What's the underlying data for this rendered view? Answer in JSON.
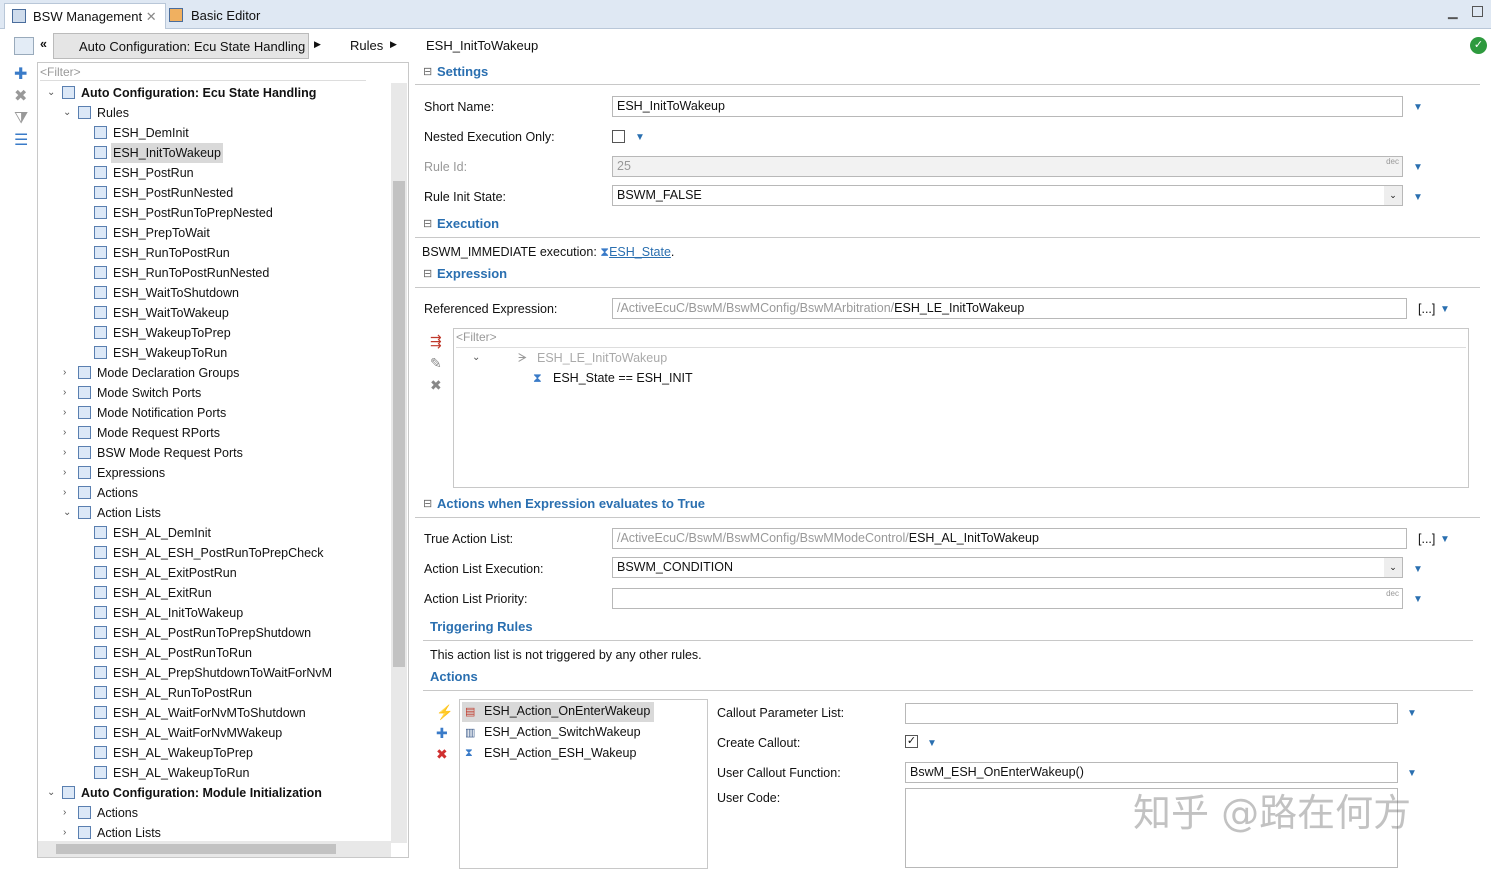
{
  "tabs": [
    {
      "label": "BSW Management",
      "active": true
    },
    {
      "label": "Basic Editor",
      "active": false
    }
  ],
  "breadcrumb": [
    "Auto Configuration: Ecu State Handling",
    "Rules",
    "ESH_InitToWakeup"
  ],
  "tree": {
    "filter_placeholder": "<Filter>",
    "items": [
      {
        "label": "Auto Configuration: Ecu State Handling",
        "level": 0,
        "bold": true,
        "expanded": true
      },
      {
        "label": "Rules",
        "level": 1,
        "expanded": true
      },
      {
        "label": "ESH_DemInit",
        "level": 2
      },
      {
        "label": "ESH_InitToWakeup",
        "level": 2,
        "selected": true
      },
      {
        "label": "ESH_PostRun",
        "level": 2
      },
      {
        "label": "ESH_PostRunNested",
        "level": 2
      },
      {
        "label": "ESH_PostRunToPrepNested",
        "level": 2
      },
      {
        "label": "ESH_PrepToWait",
        "level": 2
      },
      {
        "label": "ESH_RunToPostRun",
        "level": 2
      },
      {
        "label": "ESH_RunToPostRunNested",
        "level": 2
      },
      {
        "label": "ESH_WaitToShutdown",
        "level": 2
      },
      {
        "label": "ESH_WaitToWakeup",
        "level": 2
      },
      {
        "label": "ESH_WakeupToPrep",
        "level": 2
      },
      {
        "label": "ESH_WakeupToRun",
        "level": 2
      },
      {
        "label": "Mode Declaration Groups",
        "level": 1,
        "expanded": false
      },
      {
        "label": "Mode Switch Ports",
        "level": 1,
        "expanded": false
      },
      {
        "label": "Mode Notification Ports",
        "level": 1,
        "expanded": false
      },
      {
        "label": "Mode Request RPorts",
        "level": 1,
        "expanded": false
      },
      {
        "label": "BSW Mode Request Ports",
        "level": 1,
        "expanded": false
      },
      {
        "label": "Expressions",
        "level": 1,
        "expanded": false
      },
      {
        "label": "Actions",
        "level": 1,
        "expanded": false
      },
      {
        "label": "Action Lists",
        "level": 1,
        "expanded": true
      },
      {
        "label": "ESH_AL_DemInit",
        "level": 2
      },
      {
        "label": "ESH_AL_ESH_PostRunToPrepCheck",
        "level": 2
      },
      {
        "label": "ESH_AL_ExitPostRun",
        "level": 2
      },
      {
        "label": "ESH_AL_ExitRun",
        "level": 2
      },
      {
        "label": "ESH_AL_InitToWakeup",
        "level": 2
      },
      {
        "label": "ESH_AL_PostRunToPrepShutdown",
        "level": 2
      },
      {
        "label": "ESH_AL_PostRunToRun",
        "level": 2
      },
      {
        "label": "ESH_AL_PrepShutdownToWaitForNvM",
        "level": 2
      },
      {
        "label": "ESH_AL_RunToPostRun",
        "level": 2
      },
      {
        "label": "ESH_AL_WaitForNvMToShutdown",
        "level": 2
      },
      {
        "label": "ESH_AL_WaitForNvMWakeup",
        "level": 2
      },
      {
        "label": "ESH_AL_WakeupToPrep",
        "level": 2
      },
      {
        "label": "ESH_AL_WakeupToRun",
        "level": 2
      },
      {
        "label": "Auto Configuration: Module Initialization",
        "level": 0,
        "bold": true,
        "expanded": true
      },
      {
        "label": "Actions",
        "level": 1,
        "expanded": false
      },
      {
        "label": "Action Lists",
        "level": 1,
        "expanded": false
      }
    ]
  },
  "settings": {
    "title": "Settings",
    "short_name_label": "Short Name:",
    "short_name": "ESH_InitToWakeup",
    "nested_label": "Nested Execution Only:",
    "nested_checked": false,
    "rule_id_label": "Rule Id:",
    "rule_id": "25",
    "dec": "dec",
    "init_state_label": "Rule Init State:",
    "init_state": "BSWM_FALSE"
  },
  "execution": {
    "title": "Execution",
    "prefix": "BSWM_IMMEDIATE execution:",
    "link": "ESH_State",
    "suffix": "."
  },
  "expression": {
    "title": "Expression",
    "ref_label": "Referenced Expression:",
    "ref_path": "/ActiveEcuC/BswM/BswMConfig/BswMArbitration/",
    "ref_name": "ESH_LE_InitToWakeup",
    "browse": "[...]",
    "filter_placeholder": "<Filter>",
    "root": "ESH_LE_InitToWakeup",
    "child": "ESH_State == ESH_INIT"
  },
  "actions_true": {
    "title": "Actions when Expression evaluates to True",
    "list_label": "True Action List:",
    "list_path": "/ActiveEcuC/BswM/BswMConfig/BswMModeControl/",
    "list_name": "ESH_AL_InitToWakeup",
    "browse": "[...]",
    "exec_label": "Action List Execution:",
    "exec": "BSWM_CONDITION",
    "prio_label": "Action List Priority:",
    "prio": "",
    "dec": "dec"
  },
  "triggering": {
    "title": "Triggering Rules",
    "text": "This action list is not triggered by any other rules."
  },
  "actions": {
    "title": "Actions",
    "items": [
      "ESH_Action_OnEnterWakeup",
      "ESH_Action_SwitchWakeup",
      "ESH_Action_ESH_Wakeup"
    ],
    "callout_param_label": "Callout Parameter List:",
    "callout_param": "",
    "create_callout_label": "Create Callout:",
    "create_callout": true,
    "user_fn_label": "User Callout Function:",
    "user_fn": "BswM_ESH_OnEnterWakeup()",
    "user_code_label": "User Code:",
    "user_code": ""
  },
  "watermark": "知乎 @路在何方",
  "colors": {
    "accent": "#2a6fb0",
    "selection": "#d9d9d9",
    "tabbar": "#dfe8f3"
  }
}
